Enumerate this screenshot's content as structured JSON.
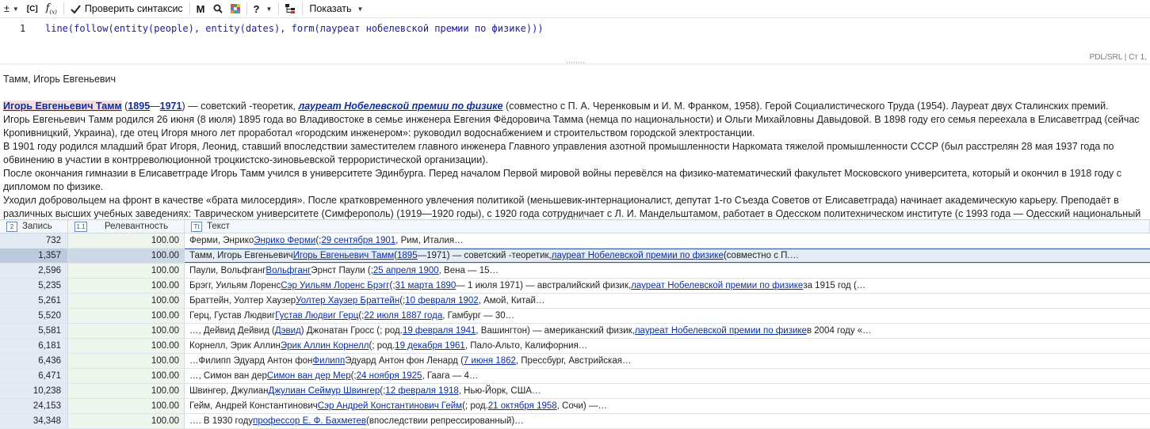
{
  "toolbar": {
    "plus_minus": "±",
    "c_label": "[C]",
    "fx_label": "f",
    "check_label": "Проверить синтаксис",
    "m_label": "M",
    "help_label": "?",
    "show_label": "Показать"
  },
  "editor": {
    "line_number": "1",
    "code": "line(follow(entity(people), entity(dates), form(лауреат нобелевской премии по физике)))",
    "mode": "PDL/SRL | Ст 1,"
  },
  "preview": {
    "title": "Тамм, Игорь Евгеньевич",
    "p1_name": "Игорь Евгеньевич Тамм",
    "p1_open": " (",
    "p1_year1": "1895",
    "p1_dash": "—",
    "p1_year2": "1971",
    "p1_mid": ") — советский -теоретик, ",
    "p1_link": "лауреат Нобелевской премии по физике",
    "p1_tail": " (совместно с П. А. Черенковым и И. М. Франком, 1958). Герой Социалистического Труда (1954). Лауреат двух Сталинских премий.",
    "p2": "Игорь Евгеньевич Тамм родился 26 июня (8 июля) 1895 года во Владивостоке в семье инженера Евгения Фёдоровича Тамма (немца по национальности) и Ольги Михайловны Давыдовой. В 1898 году его семья переехала в Елисаветград (сейчас Кропивницкий, Украина), где отец Игоря много лет проработал «городским инженером»: руководил водоснабжением и строительством городской электростанции.",
    "p3": "В 1901 году родился младший брат Игоря, Леонид, ставший впоследствии заместителем главного инженера Главного управления азотной промышленности Наркомата тяжелой промышленности СССР (был расстрелян 28 мая 1937 года по обвинению в участии в контрреволюционной троцкистско-зиновьевской террористической организации).",
    "p4": "После окончания гимназии в Елисаветграде Игорь Тамм учился в университете Эдинбурга. Перед началом Первой мировой войны перевёлся на физико-математический факультет Московского университета, который и окончил в 1918 году с дипломом по физике.",
    "p5": "Уходил добровольцем на фронт в качестве «брата милосердия». После кратковременного увлечения политикой (меньшевик-интернационалист, депутат 1-го Съезда Советов от Елисаветграда) начинает академическую карьеру. Преподаёт в различных высших учебных заведениях: Таврическом университете (Симферополь) (1919—1920 годы), с 1920 года сотрудничает с Л. И. Мандельштамом, работает в Одесском политехническом институте (с 1993 года — Одесский национальный"
  },
  "grid": {
    "headers": {
      "record": "Запись",
      "relevance": "Релевантность",
      "text": "Текст"
    },
    "header_icons": {
      "record": "2",
      "relevance": "1.1",
      "text": "Tt"
    },
    "rows": [
      {
        "record": "732",
        "relevance": "100.00",
        "t1": "Ферми, Энрико ",
        "l1": "Энрико Ферми",
        "t2": " (; ",
        "l2": "29 сентября 1901",
        "t3": ", Рим, Италия…",
        "l3": "",
        "t4": ""
      },
      {
        "record": "1,357",
        "relevance": "100.00",
        "t1": "Тамм, Игорь Евгеньевич ",
        "l1": "Игорь Евгеньевич Тамм",
        "t2": " (",
        "l2": "1895",
        "t3": "—1971) — советский -теоретик, ",
        "l3": "лауреат Нобелевской премии по физике",
        "t4": " (совместно с П.…"
      },
      {
        "record": "2,596",
        "relevance": "100.00",
        "t1": "Паули, Вольфганг ",
        "l1": "Вольфганг",
        "t2": " Эрнст Паули (; ",
        "l2": "25 апреля 1900",
        "t3": ", Вена — 15…",
        "l3": "",
        "t4": ""
      },
      {
        "record": "5,235",
        "relevance": "100.00",
        "t1": "Брэгг, Уильям Лоренс ",
        "l1": "Сэр Уильям Лоренс Брэгг",
        "t2": " (; ",
        "l2": "31 марта 1890",
        "t3": " — 1 июля 1971) — австралийский физик, ",
        "l3": "лауреат Нобелевской премии по физике",
        "t4": " за 1915 год (…"
      },
      {
        "record": "5,261",
        "relevance": "100.00",
        "t1": "Браттейн, Уолтер Хаузер ",
        "l1": "Уолтер Хаузер Браттейн",
        "t2": " (; ",
        "l2": "10 февраля 1902",
        "t3": ", Амой, Китай…",
        "l3": "",
        "t4": ""
      },
      {
        "record": "5,520",
        "relevance": "100.00",
        "t1": "Герц, Густав Людвиг ",
        "l1": "Густав Людвиг Герц",
        "t2": " (; ",
        "l2": "22 июля 1887 года",
        "t3": ", Гамбург — 30…",
        "l3": "",
        "t4": ""
      },
      {
        "record": "5,581",
        "relevance": "100.00",
        "t1": "…, Дейвид Дейвид (",
        "l1": "Дэвид",
        "t2": ") Джонатан Гросс (; род. ",
        "l2": "19 февраля 1941",
        "t3": ", Вашингтон) — американский физик, ",
        "l3": "лауреат Нобелевской премии по физике",
        "t4": " в 2004 году «…"
      },
      {
        "record": "6,181",
        "relevance": "100.00",
        "t1": "Корнелл, Эрик Аллин ",
        "l1": "Эрик Аллин Корнелл",
        "t2": " (; род. ",
        "l2": "19 декабря 1961",
        "t3": ", Пало-Альто, Калифорния…",
        "l3": "",
        "t4": ""
      },
      {
        "record": "6,436",
        "relevance": "100.00",
        "t1": "…Филипп Эдуард Антон фон ",
        "l1": "Филипп",
        "t2": " Эдуард Антон фон Ленард ( ",
        "l2": "7 июня 1862",
        "t3": ", Прессбург, Австрийская…",
        "l3": "",
        "t4": ""
      },
      {
        "record": "6,471",
        "relevance": "100.00",
        "t1": "…, Симон ван дер ",
        "l1": "Симон ван дер Мер",
        "t2": " (; ",
        "l2": "24 ноября 1925",
        "t3": ", Гаага — 4…",
        "l3": "",
        "t4": ""
      },
      {
        "record": "10,238",
        "relevance": "100.00",
        "t1": "Швингер, Джулиан ",
        "l1": "Джулиан Сеймур Швингер",
        "t2": " (; ",
        "l2": "12 февраля 1918",
        "t3": ", Нью-Йорк, США…",
        "l3": "",
        "t4": ""
      },
      {
        "record": "24,153",
        "relevance": "100.00",
        "t1": "Гейм, Андрей Константинович ",
        "l1": "Сэр Андрей Константинович Гейм",
        "t2": " (; род. ",
        "l2": "21 октября 1958",
        "t3": ", Сочи) —…",
        "l3": "",
        "t4": ""
      },
      {
        "record": "34,348",
        "relevance": "100.00",
        "t1": "…. В 1930 году ",
        "l1": "профессор Е. Ф. Бахметев",
        "t2": " (впоследствии репрессированный)…",
        "l2": "",
        "t3": "",
        "l3": "",
        "t4": ""
      }
    ],
    "selected_index": 1
  }
}
